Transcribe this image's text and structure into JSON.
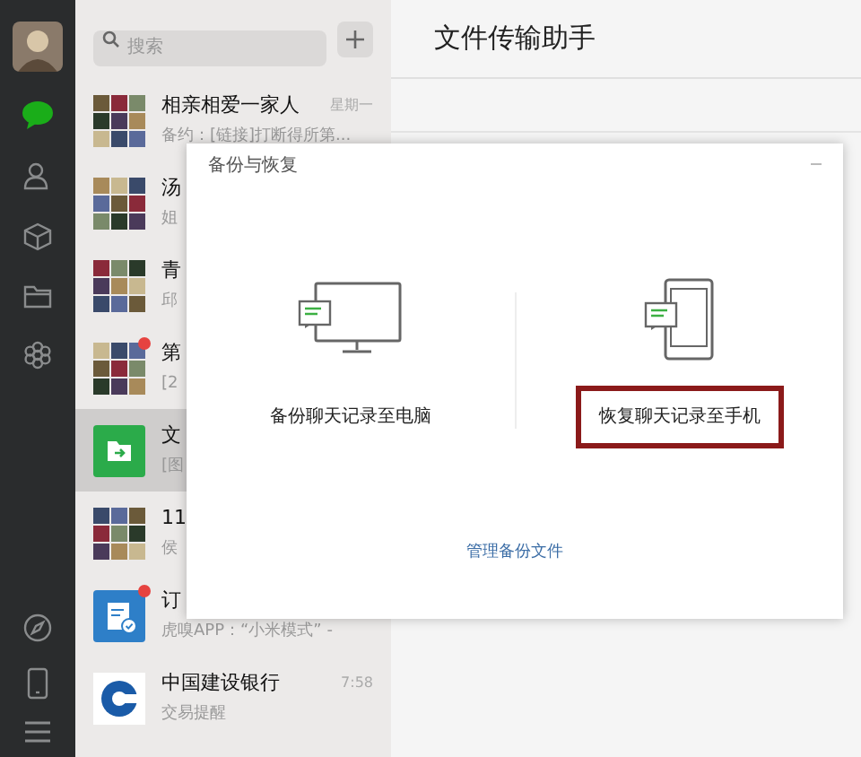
{
  "search": {
    "placeholder": "搜索"
  },
  "chats": [
    {
      "kind": "group",
      "name": "相亲相爱一家人",
      "preview": "备约：[链接]打断得所第...",
      "time": "星期一",
      "unread": false,
      "selected": false
    },
    {
      "kind": "group",
      "name": "汤",
      "preview": "姐",
      "unread": false,
      "selected": false
    },
    {
      "kind": "group",
      "name": "青",
      "preview": "邱",
      "unread": false,
      "selected": false
    },
    {
      "kind": "group",
      "name": "第",
      "preview": "[2",
      "unread": true,
      "selected": false
    },
    {
      "kind": "folder",
      "name": "文",
      "preview": "[图",
      "unread": false,
      "selected": true
    },
    {
      "kind": "group",
      "name": "11",
      "preview": "侯",
      "unread": false,
      "selected": false
    },
    {
      "kind": "subscription",
      "name": "订",
      "preview": "虎嗅APP：“小米模式” -",
      "unread": true,
      "selected": false
    },
    {
      "kind": "bank",
      "name": "中国建设银行",
      "preview": "交易提醒",
      "time": "7:58",
      "unread": false,
      "selected": false
    }
  ],
  "conversation": {
    "title": "文件传输助手"
  },
  "dialog": {
    "title": "备份与恢复",
    "options": [
      {
        "kind": "computer",
        "label": "备份聊天记录至电脑",
        "highlighted": false
      },
      {
        "kind": "phone",
        "label": "恢复聊天记录至手机",
        "highlighted": true
      }
    ],
    "link": "管理备份文件"
  }
}
